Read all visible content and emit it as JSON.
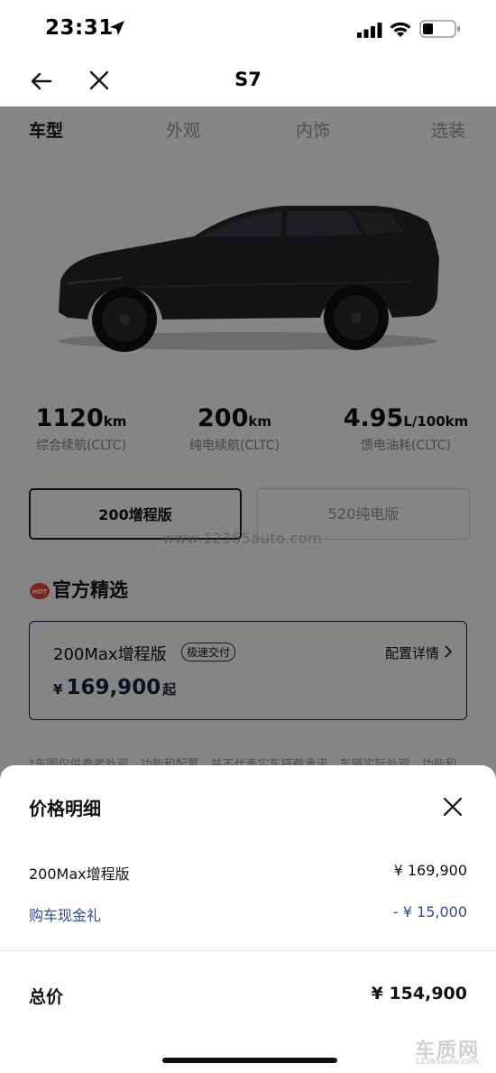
{
  "status_bar": {
    "time": "23:31"
  },
  "nav": {
    "title": "S7"
  },
  "tabs": [
    {
      "label": "车型",
      "active": true
    },
    {
      "label": "外观",
      "active": false
    },
    {
      "label": "内饰",
      "active": false
    },
    {
      "label": "选装",
      "active": false
    }
  ],
  "specs": [
    {
      "value": "1120",
      "unit": "km",
      "label": "综合续航(CLTC)"
    },
    {
      "value": "200",
      "unit": "km",
      "label": "纯电续航(CLTC)"
    },
    {
      "value": "4.95",
      "unit": "L/100km",
      "label": "馈电油耗(CLTC)"
    }
  ],
  "versions": {
    "selected": "200增程版",
    "other": "520纯电版"
  },
  "watermark": "www.12365auto.com",
  "featured": {
    "title": "官方精选",
    "icon_text": "HOT",
    "trim_name": "200Max增程版",
    "badge": "极速交付",
    "link_label": "配置详情",
    "price_symbol": "¥",
    "price": "169,900",
    "price_suffix": "起"
  },
  "disclaimer": "*车图仅供参考外观、功能和配置，并不代表实车搭载承诺，车辆实际外观、功能和",
  "price_sheet": {
    "title": "价格明细",
    "items": [
      {
        "label": "200Max增程版",
        "value": "¥ 169,900"
      },
      {
        "label": "购车现金礼",
        "value": "- ¥ 15,000"
      }
    ],
    "total_label": "总价",
    "total_value": "¥ 154,900"
  },
  "logo_watermark": {
    "big": "车质网",
    "small": "12365auto.com"
  },
  "colors": {
    "navy": "#1a2340",
    "discount_blue": "#2b4a9a",
    "overlay": "rgba(0,0,0,0.48)"
  }
}
